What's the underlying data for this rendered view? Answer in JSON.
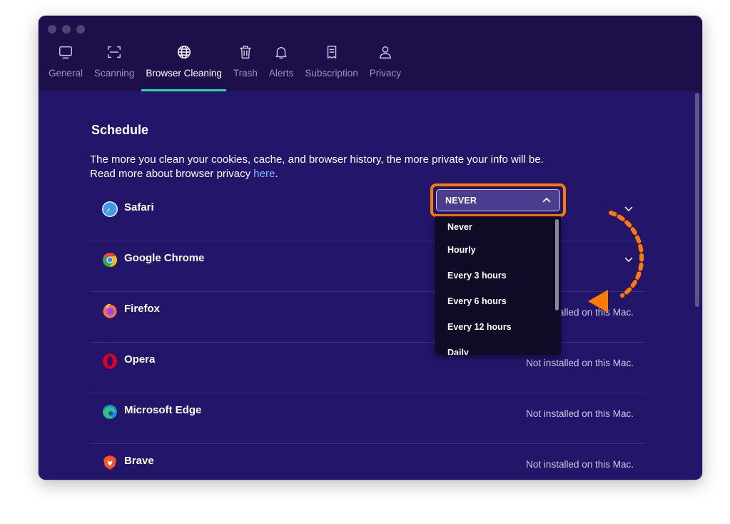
{
  "window": {
    "traffic_lights": [
      "close",
      "minimize",
      "zoom"
    ]
  },
  "tabs": [
    {
      "label": "General",
      "icon": "monitor-icon",
      "active": false
    },
    {
      "label": "Scanning",
      "icon": "scan-icon",
      "active": false
    },
    {
      "label": "Browser Cleaning",
      "icon": "globe-icon",
      "active": true
    },
    {
      "label": "Trash",
      "icon": "trash-icon",
      "active": false
    },
    {
      "label": "Alerts",
      "icon": "bell-icon",
      "active": false
    },
    {
      "label": "Subscription",
      "icon": "receipt-icon",
      "active": false
    },
    {
      "label": "Privacy",
      "icon": "person-icon",
      "active": false
    }
  ],
  "schedule": {
    "title": "Schedule",
    "description_line1": "The more you clean your cookies, cache, and browser history, the more private your info will be.",
    "description_line2_prefix": "Read more about browser privacy ",
    "description_link": "here",
    "description_line2_suffix": "."
  },
  "browsers": [
    {
      "name": "Safari",
      "icon": "safari-icon",
      "status": ""
    },
    {
      "name": "Google Chrome",
      "icon": "chrome-icon",
      "status": ""
    },
    {
      "name": "Firefox",
      "icon": "firefox-icon",
      "status": "Not installed on this Mac."
    },
    {
      "name": "Opera",
      "icon": "opera-icon",
      "status": "Not installed on this Mac."
    },
    {
      "name": "Microsoft Edge",
      "icon": "edge-icon",
      "status": "Not installed on this Mac."
    },
    {
      "name": "Brave",
      "icon": "brave-icon",
      "status": "Not installed on this Mac."
    }
  ],
  "dropdown": {
    "selected": "NEVER",
    "options": [
      "Never",
      "Hourly",
      "Every 3 hours",
      "Every 6 hours",
      "Every 12 hours",
      "Daily"
    ]
  },
  "colors": {
    "background": "#23156a",
    "titlebar": "#1c0f4a",
    "accent_tab": "#2ed3a8",
    "highlight": "#ff7a00",
    "link": "#7eb8ff"
  }
}
